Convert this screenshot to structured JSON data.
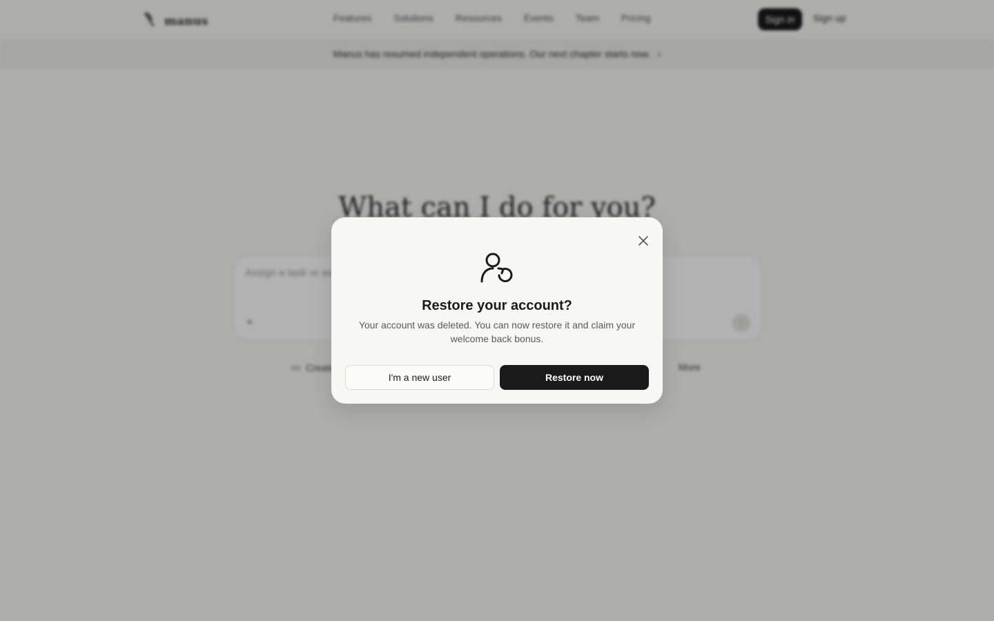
{
  "background": {
    "brand": "manus",
    "nav_items": [
      "Features",
      "Solutions",
      "Resources",
      "Events",
      "Team",
      "Pricing"
    ],
    "signin_label": "Sign in",
    "signup_label": "Sign up",
    "announcement": "Manus has resumed independent operations. Our next chapter starts now.",
    "hero_title": "What can I do for you?",
    "composer_placeholder": "Assign a task or ask anything",
    "chip_create": "Create",
    "chip_more": "More"
  },
  "modal": {
    "icon": "user-restore-icon",
    "title": "Restore your account?",
    "message": "Your account was deleted. You can now restore it and claim your welcome back bonus.",
    "secondary_label": "I'm a new user",
    "primary_label": "Restore now"
  },
  "colors": {
    "primary_button": "#1a1a1a",
    "overlay": "rgba(0,0,0,0.30)",
    "modal_bg": "#f7f7f5"
  }
}
